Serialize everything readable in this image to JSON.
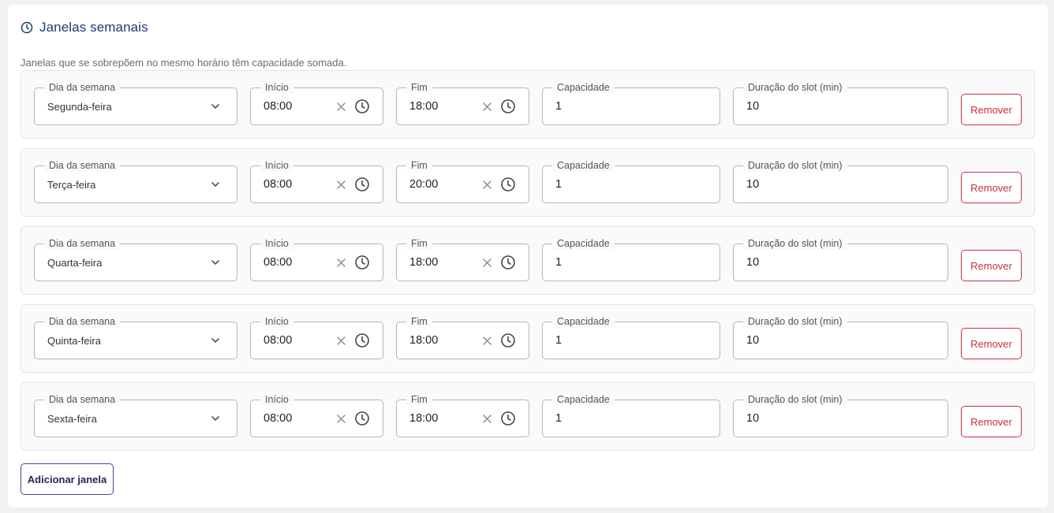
{
  "section": {
    "title": "Janelas semanais",
    "subtitle": "Janelas que se sobrepõem no mesmo horário têm capacidade somada."
  },
  "labels": {
    "day": "Dia da semana",
    "start": "Início",
    "end": "Fim",
    "capacity": "Capacidade",
    "duration": "Duração do slot (min)",
    "remove": "Remover"
  },
  "windows": [
    {
      "day": "Segunda-feira",
      "start": "08:00",
      "end": "18:00",
      "capacity": "1",
      "duration": "10"
    },
    {
      "day": "Terça-feira",
      "start": "08:00",
      "end": "20:00",
      "capacity": "1",
      "duration": "10"
    },
    {
      "day": "Quarta-feira",
      "start": "08:00",
      "end": "18:00",
      "capacity": "1",
      "duration": "10"
    },
    {
      "day": "Quinta-feira",
      "start": "08:00",
      "end": "18:00",
      "capacity": "1",
      "duration": "10"
    },
    {
      "day": "Sexta-feira",
      "start": "08:00",
      "end": "18:00",
      "capacity": "1",
      "duration": "10"
    }
  ],
  "add_button": "Adicionar janela",
  "colors": {
    "title": "#1f3b73",
    "remove": "#c9323a",
    "add_border": "#5b3e8c"
  },
  "icons": {
    "header": "clock-icon",
    "select": "chevron-down-icon",
    "clear": "close-icon",
    "time": "clock-icon"
  }
}
